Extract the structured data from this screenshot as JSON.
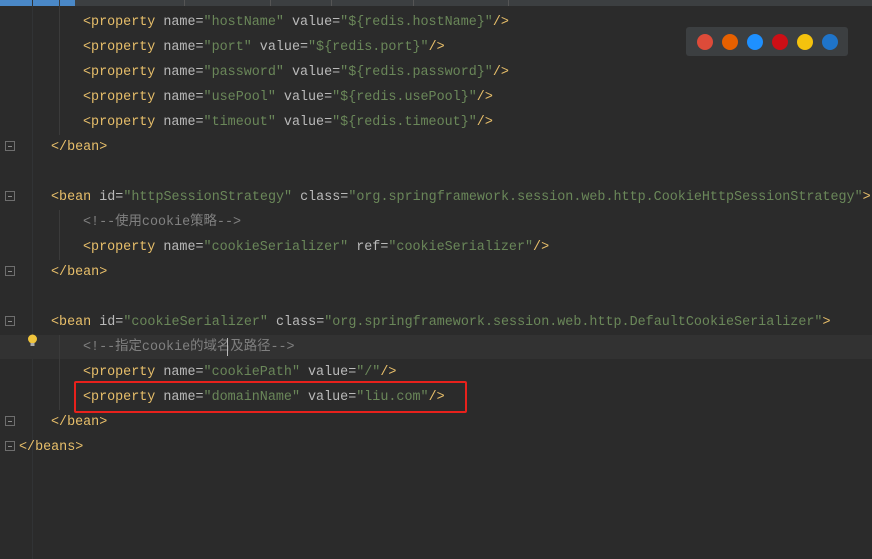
{
  "lines": [
    {
      "indent": 2,
      "parts": [
        [
          "t",
          "<property "
        ],
        [
          "a",
          "name="
        ],
        [
          "v",
          "\"hostName\""
        ],
        [
          "a",
          " value="
        ],
        [
          "v",
          "\"${redis.hostName}\""
        ],
        [
          "t",
          "/>"
        ]
      ]
    },
    {
      "indent": 2,
      "parts": [
        [
          "t",
          "<property "
        ],
        [
          "a",
          "name="
        ],
        [
          "v",
          "\"port\""
        ],
        [
          "a",
          " value="
        ],
        [
          "v",
          "\"${redis.port}\""
        ],
        [
          "t",
          "/>"
        ]
      ]
    },
    {
      "indent": 2,
      "parts": [
        [
          "t",
          "<property "
        ],
        [
          "a",
          "name="
        ],
        [
          "v",
          "\"password\""
        ],
        [
          "a",
          " value="
        ],
        [
          "v",
          "\"${redis.password}\""
        ],
        [
          "t",
          "/>"
        ]
      ]
    },
    {
      "indent": 2,
      "parts": [
        [
          "t",
          "<property "
        ],
        [
          "a",
          "name="
        ],
        [
          "v",
          "\"usePool\""
        ],
        [
          "a",
          " value="
        ],
        [
          "v",
          "\"${redis.usePool}\""
        ],
        [
          "t",
          "/>"
        ]
      ]
    },
    {
      "indent": 2,
      "parts": [
        [
          "t",
          "<property "
        ],
        [
          "a",
          "name="
        ],
        [
          "v",
          "\"timeout\""
        ],
        [
          "a",
          " value="
        ],
        [
          "v",
          "\"${redis.timeout}\""
        ],
        [
          "t",
          "/>"
        ]
      ]
    },
    {
      "indent": 1,
      "parts": [
        [
          "t",
          "</bean>"
        ]
      ]
    },
    {
      "indent": 0,
      "parts": []
    },
    {
      "indent": 1,
      "parts": [
        [
          "t",
          "<bean "
        ],
        [
          "a",
          "id="
        ],
        [
          "v",
          "\"httpSessionStrategy\""
        ],
        [
          "a",
          " class="
        ],
        [
          "v",
          "\"org.springframework.session.web.http.CookieHttpSessionStrategy\""
        ],
        [
          "t",
          ">"
        ]
      ]
    },
    {
      "indent": 2,
      "parts": [
        [
          "c",
          "<!--使用cookie策略-->"
        ]
      ]
    },
    {
      "indent": 2,
      "parts": [
        [
          "t",
          "<property "
        ],
        [
          "a",
          "name="
        ],
        [
          "v",
          "\"cookieSerializer\""
        ],
        [
          "a",
          " ref="
        ],
        [
          "v",
          "\"cookieSerializer\""
        ],
        [
          "t",
          "/>"
        ]
      ]
    },
    {
      "indent": 1,
      "parts": [
        [
          "t",
          "</bean>"
        ]
      ]
    },
    {
      "indent": 0,
      "parts": []
    },
    {
      "indent": 1,
      "parts": [
        [
          "t",
          "<bean "
        ],
        [
          "a",
          "id="
        ],
        [
          "v",
          "\"cookieSerializer\""
        ],
        [
          "a",
          " class="
        ],
        [
          "v",
          "\"org.springframework.session.web.http.DefaultCookieSerializer\""
        ],
        [
          "t",
          ">"
        ]
      ]
    },
    {
      "indent": 2,
      "parts": [
        [
          "c",
          "<!--指定cookie的域名及路径-->"
        ]
      ]
    },
    {
      "indent": 2,
      "parts": [
        [
          "t",
          "<property "
        ],
        [
          "a",
          "name="
        ],
        [
          "v",
          "\"cookiePath\""
        ],
        [
          "a",
          " value="
        ],
        [
          "v",
          "\"/\""
        ],
        [
          "t",
          "/>"
        ]
      ]
    },
    {
      "indent": 2,
      "parts": [
        [
          "t",
          "<property "
        ],
        [
          "a",
          "name="
        ],
        [
          "v",
          "\"domainName\""
        ],
        [
          "a",
          " value="
        ],
        [
          "v",
          "\"liu.com\""
        ],
        [
          "t",
          "/>"
        ]
      ]
    },
    {
      "indent": 1,
      "parts": [
        [
          "t",
          "</bean>"
        ]
      ]
    },
    {
      "indent": 0,
      "parts": [
        [
          "t",
          "</beans>"
        ]
      ]
    }
  ],
  "browsers": [
    {
      "name": "chrome-icon",
      "color": "#dd4b39"
    },
    {
      "name": "firefox-icon",
      "color": "#e66000"
    },
    {
      "name": "safari-icon",
      "color": "#1e90ff"
    },
    {
      "name": "opera-icon",
      "color": "#cc0f16"
    },
    {
      "name": "ie-icon",
      "color": "#f4c20d"
    },
    {
      "name": "edge-icon",
      "color": "#1f74c9"
    }
  ],
  "colors": {
    "tag": "#e8bf6a",
    "attr": "#bababa",
    "value": "#6a8759",
    "comment": "#808080",
    "highlight_box": "#e8211c"
  }
}
